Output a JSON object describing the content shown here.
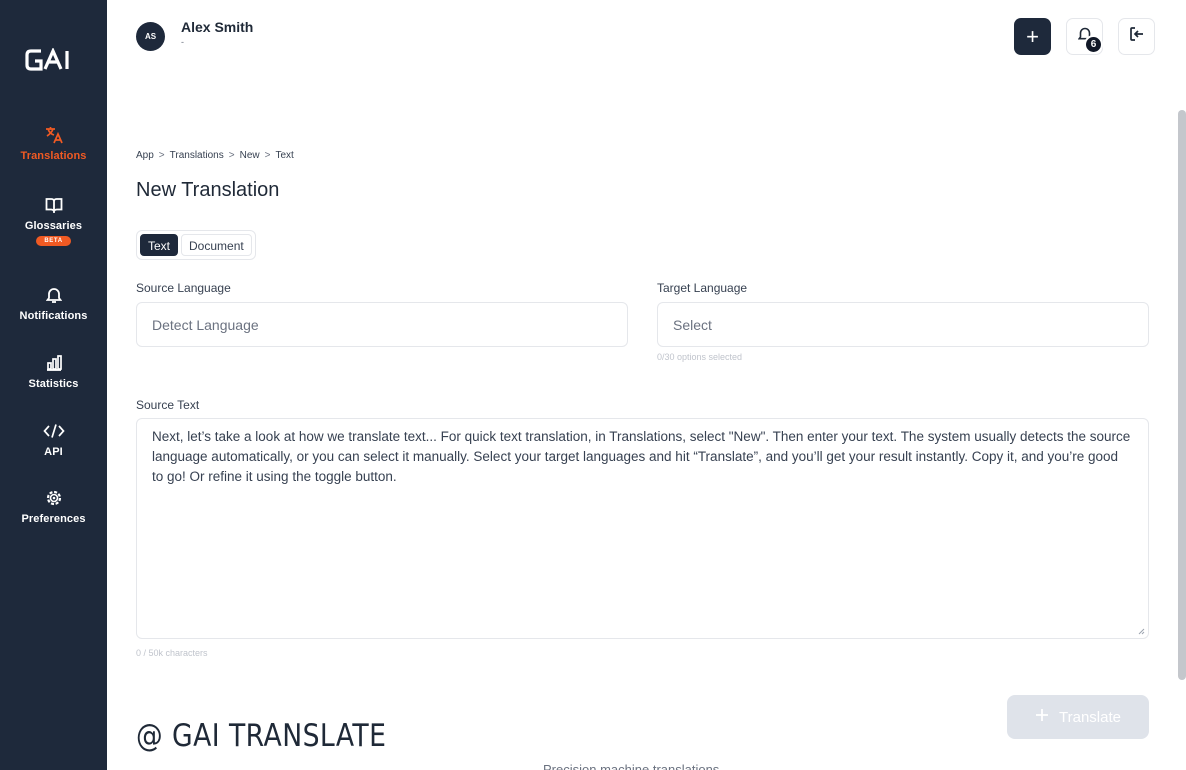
{
  "sidebar": {
    "logo": "GAI",
    "items": [
      {
        "label": "Translations",
        "icon": "translate-icon",
        "active": true
      },
      {
        "label": "Glossaries",
        "icon": "book-icon",
        "badge": "BETA"
      },
      {
        "label": "Notifications",
        "icon": "bell-icon"
      },
      {
        "label": "Statistics",
        "icon": "chart-icon"
      },
      {
        "label": "API",
        "icon": "code-icon"
      },
      {
        "label": "Preferences",
        "icon": "gear-icon"
      }
    ]
  },
  "header": {
    "avatar_initials": "AS",
    "user_name": "Alex Smith",
    "user_sub": "-",
    "add_label": "+",
    "notification_count": "6"
  },
  "breadcrumb": [
    "App",
    "Translations",
    "New",
    "Text"
  ],
  "breadcrumb_sep": ">",
  "page_title": "New Translation",
  "tabs": [
    "Text",
    "Document"
  ],
  "form": {
    "source_language_label": "Source Language",
    "source_language_placeholder": "Detect Language",
    "target_language_label": "Target Language",
    "target_language_placeholder": "Select",
    "target_hint": "0/30 options selected",
    "source_text_label": "Source Text",
    "source_text_value": "Next, let’s take a look at how we translate text... For quick text translation, in Translations, select \"New\". Then enter your text. The system usually detects the source language automatically, or you can select it manually. Select your target languages and hit “Translate”, and you’ll get your result instantly. Copy it, and you’re good to go! Or refine it using the toggle button.",
    "char_count": "0 / 50k characters"
  },
  "translate_button": "Translate",
  "watermark": "@ GAI TRANSLATE",
  "footer_text": "Precision machine translations",
  "colors": {
    "sidebar_bg": "#1e293b",
    "accent": "#f05a23"
  }
}
